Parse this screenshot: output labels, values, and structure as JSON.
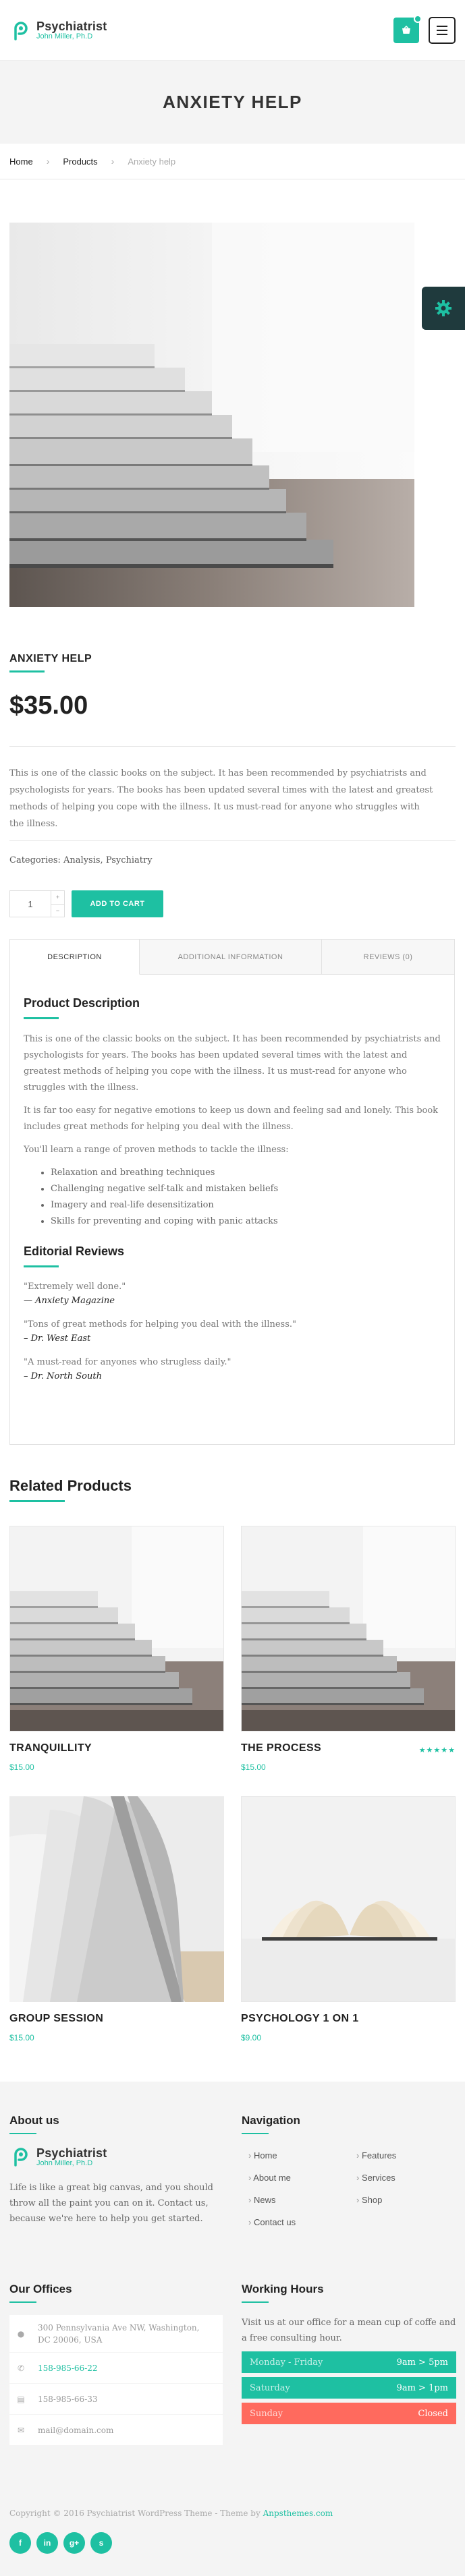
{
  "header": {
    "brand": "Psychiatrist",
    "subtitle": "John Miller, Ph.D"
  },
  "hero": {
    "title": "ANXIETY HELP"
  },
  "breadcrumb": {
    "home": "Home",
    "products": "Products",
    "current": "Anxiety help"
  },
  "product": {
    "title": "ANXIETY HELP",
    "price": "$35.00",
    "short_description": "This is one of the classic books on the subject. It has been recommended by psychiatrists and psychologists for years. The books has been updated several times with the latest and greatest methods of helping you cope with the illness. It us must-read for anyone who struggles with the illness.",
    "categories_label": "Categories:",
    "categories": [
      "Analysis",
      "Psychiatry"
    ],
    "quantity": "1",
    "add_to_cart": "ADD TO CART"
  },
  "tabs": [
    {
      "label": "DESCRIPTION"
    },
    {
      "label": "ADDITIONAL INFORMATION"
    },
    {
      "label": "REVIEWS (0)"
    }
  ],
  "description": {
    "heading": "Product Description",
    "p1": "This is one of the classic books on the subject. It has been recommended by psychiatrists and psychologists for years. The books has been updated several times with the latest and greatest methods of helping you cope with the illness. It us must-read for anyone who struggles with the illness.",
    "p2": "It is far too easy for negative emotions to keep us down and feeling sad and lonely. This book includes great methods for helping you deal with the illness.",
    "p3": "You'll learn a range of proven methods to tackle the illness:",
    "bullets": [
      "Relaxation and breathing techniques",
      "Challenging negative self-talk and mistaken beliefs",
      "Imagery and real-life desensitization",
      "Skills for preventing and coping with panic attacks"
    ],
    "reviews_heading": "Editorial Reviews",
    "reviews": [
      {
        "quote": "\"Extremely well done.\"",
        "author": "— Anxiety Magazine"
      },
      {
        "quote": "\"Tons of great methods for helping you deal with the illness.\"",
        "author": "– Dr. West East"
      },
      {
        "quote": "\"A must-read for anyones who strugless daily.\"",
        "author": "– Dr. North South"
      }
    ]
  },
  "related": {
    "heading": "Related Products",
    "items": [
      {
        "name": "TRANQUILLITY",
        "price": "$15.00"
      },
      {
        "name": "THE PROCESS",
        "price": "$15.00",
        "stars": "★★★★★"
      },
      {
        "name": "GROUP SESSION",
        "price": "$15.00"
      },
      {
        "name": "PSYCHOLOGY 1 ON 1",
        "price": "$9.00"
      }
    ]
  },
  "footer": {
    "about_heading": "About us",
    "about_brand": "Psychiatrist",
    "about_sub": "John Miller, Ph.D",
    "about_text": "Life is like a great big canvas, and you should throw all the paint you can on it. Contact us, because we're here to help you get started.",
    "nav_heading": "Navigation",
    "nav": [
      "Home",
      "Features",
      "About me",
      "Services",
      "News",
      "Shop",
      "Contact us"
    ],
    "offices_heading": "Our Offices",
    "address": "300 Pennsylvania Ave NW, Washington, DC 20006, USA",
    "phone1": "158-985-66-22",
    "phone2": "158-985-66-33",
    "email": "mail@domain.com",
    "hours_heading": "Working Hours",
    "hours_text": "Visit us at our office for a mean cup of coffe and a free consulting hour.",
    "hours": [
      {
        "day": "Monday - Friday",
        "time": "9am > 5pm",
        "color": "#1ec0a2"
      },
      {
        "day": "Saturday",
        "time": "9am > 1pm",
        "color": "#1ec0a2"
      },
      {
        "day": "Sunday",
        "time": "Closed",
        "color": "#ff6a5e"
      }
    ],
    "copyright": "Copyright © 2016 Psychiatrist WordPress Theme - Theme by",
    "copyright_link": "Anpsthemes.com",
    "socials": [
      "f",
      "in",
      "g+",
      "s"
    ]
  },
  "colors": {
    "accent": "#1ec0a2",
    "closed": "#ff6a5e",
    "settings_tab": "#1f3a3d"
  },
  "icons": [
    "logo-icon",
    "cart-icon",
    "menu-icon",
    "gear-icon",
    "location-icon",
    "phone-icon",
    "mail-icon"
  ]
}
